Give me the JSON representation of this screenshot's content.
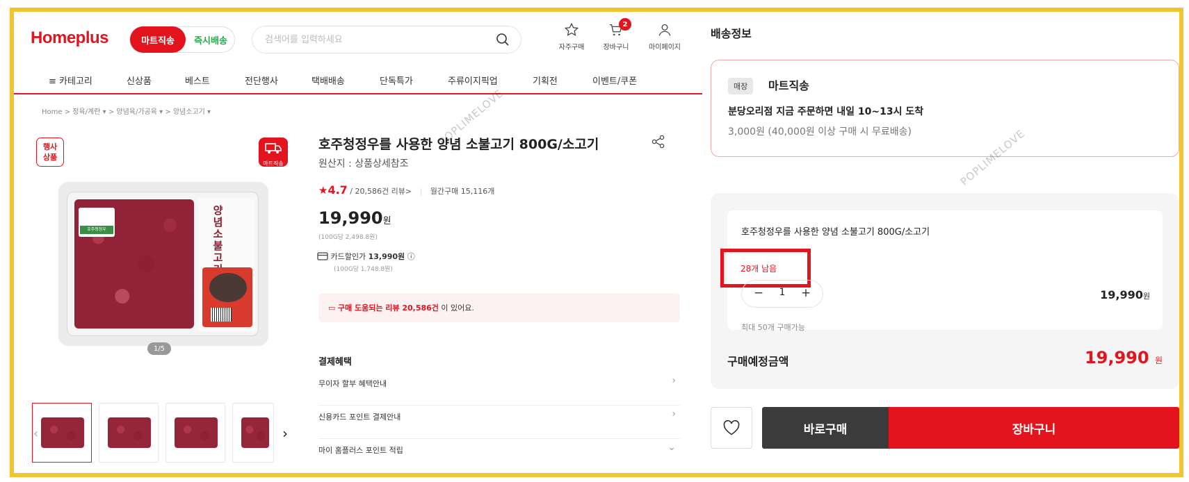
{
  "header": {
    "logo": "Homeplus",
    "mode_active": "마트직송",
    "mode_inactive": "즉시배송",
    "search_placeholder": "검색어를 입력하세요",
    "icons": [
      {
        "label": "자주구매",
        "icon": "star-icon"
      },
      {
        "label": "장바구니",
        "icon": "cart-icon",
        "badge": "2"
      },
      {
        "label": "마이페이지",
        "icon": "user-icon"
      }
    ]
  },
  "nav": {
    "items": [
      "≡ 카테고리",
      "신상품",
      "베스트",
      "전단행사",
      "택배배송",
      "단독특가",
      "주류이지픽업",
      "기획전",
      "이벤트/쿠폰"
    ]
  },
  "breadcrumb": "Home  >  정육/계란 ▾  >  양념육/가공육 ▾  >  양념소고기 ▾",
  "gallery": {
    "event_badge": "행사\n상품",
    "mart_badge": "마트직송",
    "package_brand": "호주청정우",
    "package_title": "양념소불고기",
    "pager": "1/5"
  },
  "product": {
    "title": "호주청정우를 사용한 양념 소불고기 800G/소고기",
    "origin": "원산지 : 상품상세참조",
    "rating_star": "★",
    "rating": "4.7",
    "review_count": "/ 20,586건 리뷰>",
    "monthly_sales": "월간구매 15,116개",
    "price": "19,990",
    "price_unit": "원",
    "unit_price": "(100G당 2,498.8원)",
    "card_label": "카드할인가",
    "card_price": "13,990원",
    "card_unit": "(100G당 1,748.8원)",
    "review_text_prefix": "구매 도움되는 리뷰 20,586건",
    "review_text_suffix": " 이 있어요.",
    "benefit_title": "결제혜택",
    "benefits": [
      {
        "label": "무이자 할부 혜택안내",
        "chevron": "›"
      },
      {
        "label": "신용카드 포인트 결제안내",
        "chevron": "›"
      },
      {
        "label": "마이 홈플러스 포인트 적립",
        "chevron": "⌄"
      }
    ]
  },
  "shipping": {
    "title": "배송정보",
    "tag": "매장",
    "name": "마트직송",
    "line1": "분당오리점 지금 주문하면 내일 10~13시 도착",
    "line2": "3,000원 (40,000원 이상 구매 시 무료배송)"
  },
  "order": {
    "item_title": "호주청정우를 사용한 양념 소불고기 800G/소고기",
    "stock_left": "28개 남음",
    "qty": "1",
    "minus": "−",
    "plus": "+",
    "line_price": "19,990",
    "line_price_unit": "원",
    "max_text": "최대 50개 구매가능",
    "total_label": "구매예정금액",
    "total_price": "19,990",
    "total_unit": "원"
  },
  "actions": {
    "buy_now": "바로구매",
    "add_cart": "장바구니"
  },
  "watermark": "POPLIMELOVE",
  "colors": {
    "brand": "#e3141e",
    "green": "#2ea34d",
    "frame": "#f4c430",
    "dark_button": "#3b3b3b"
  }
}
